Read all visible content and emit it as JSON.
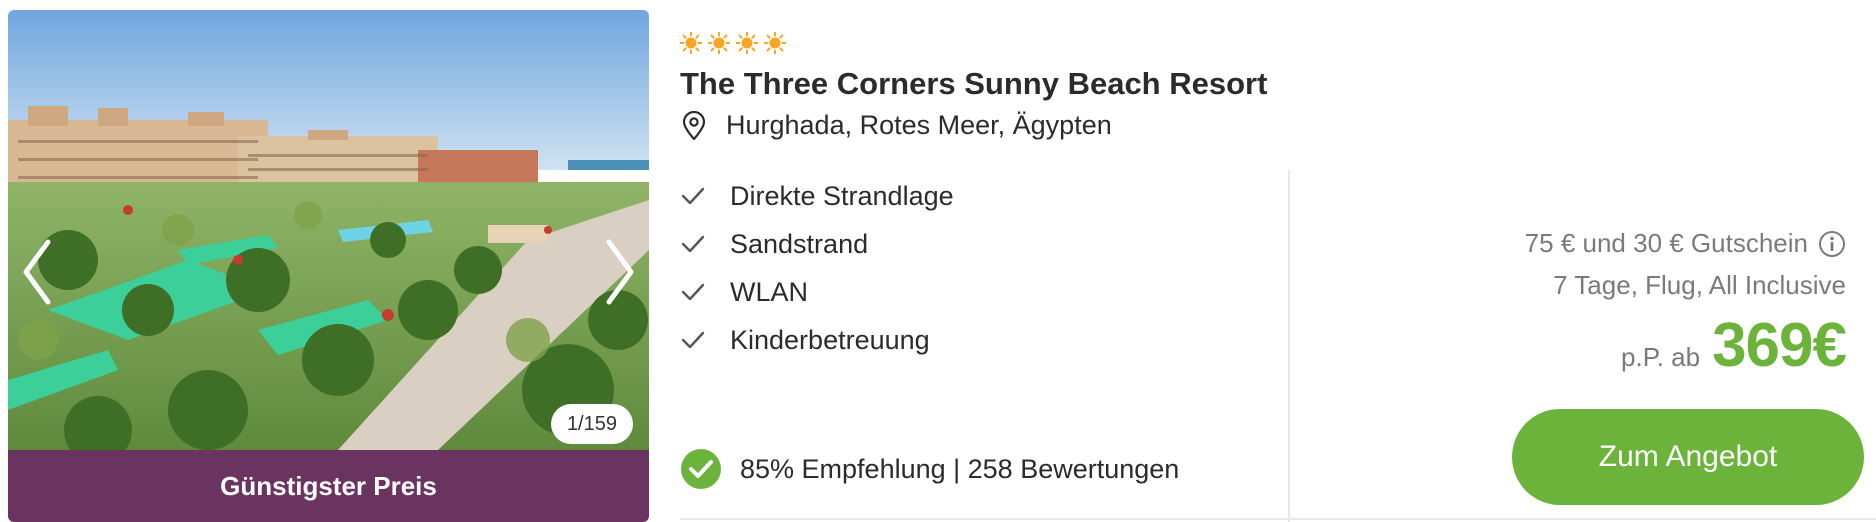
{
  "hotel": {
    "stars": 4,
    "star_color": "#f5a623",
    "name": "The Three Corners Sunny Beach Resort",
    "location": "Hurghada, Rotes Meer, Ägypten",
    "location_icon": "map-pin-icon"
  },
  "gallery": {
    "counter": "1/159",
    "badge": "Günstigster Preis",
    "badge_color": "#6b3360",
    "prev_icon": "chevron-left-icon",
    "next_icon": "chevron-right-icon"
  },
  "features": [
    {
      "label": "Direkte Strandlage",
      "icon": "check-icon"
    },
    {
      "label": "Sandstrand",
      "icon": "check-icon"
    },
    {
      "label": "WLAN",
      "icon": "check-icon"
    },
    {
      "label": "Kinderbetreuung",
      "icon": "check-icon"
    }
  ],
  "rating": {
    "text": "85% Empfehlung | 258 Bewertungen",
    "icon": "check-circle-icon",
    "icon_color": "#6bb33a"
  },
  "offer": {
    "voucher": "75 € und 30 € Gutschein",
    "info_icon": "info-icon",
    "trip": "7 Tage, Flug, All Inclusive",
    "price_prefix": "p.P. ab",
    "price": "369€",
    "price_color": "#6bb33a",
    "cta_label": "Zum Angebot",
    "cta_color": "#6bb33a"
  }
}
